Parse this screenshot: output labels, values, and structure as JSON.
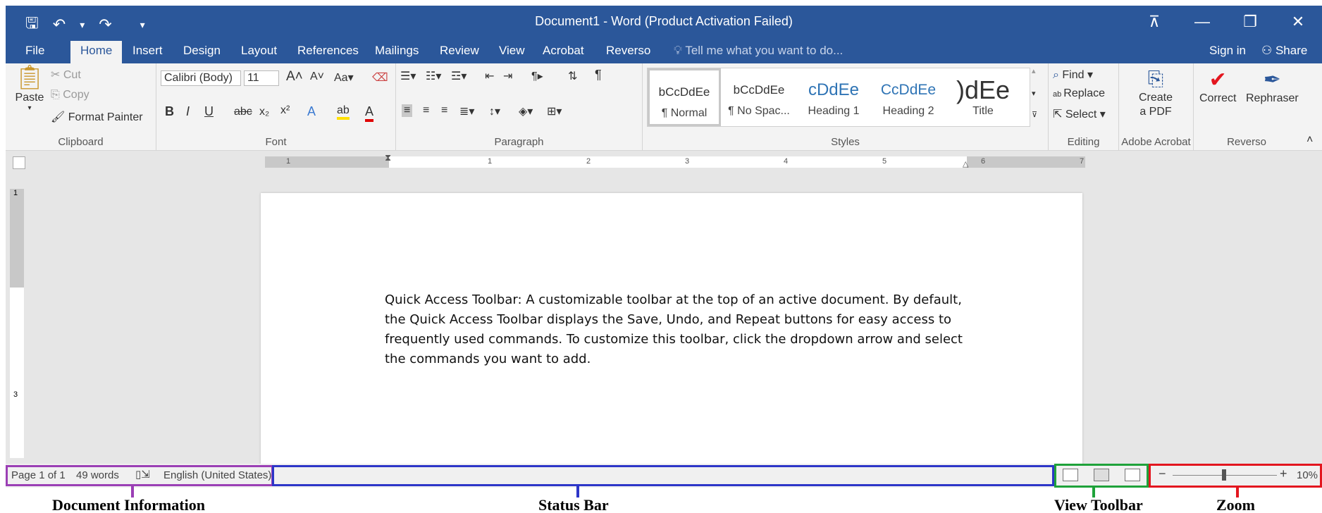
{
  "titlebar": {
    "title": "Document1 - Word (Product Activation Failed)",
    "qat": [
      {
        "icon": "save-icon",
        "glyph": "🖫"
      },
      {
        "icon": "undo-icon",
        "glyph": "↶"
      },
      {
        "icon": "undo-dropdown-icon",
        "glyph": "▾"
      },
      {
        "icon": "redo-icon",
        "glyph": "↷"
      },
      {
        "icon": "customize-qat-icon",
        "glyph": "▾"
      }
    ],
    "controls": {
      "ribbon_display": "⊼",
      "minimize": "—",
      "restore": "❐",
      "close": "✕"
    }
  },
  "tabs": [
    "File",
    "Home",
    "Insert",
    "Design",
    "Layout",
    "References",
    "Mailings",
    "Review",
    "View",
    "Acrobat",
    "Reverso"
  ],
  "active_tab": "Home",
  "tell_me": "Tell me what you want to do...",
  "sign_in": "Sign in",
  "share": "Share",
  "ribbon": {
    "clipboard": {
      "label": "Clipboard",
      "paste": "Paste",
      "cut": "Cut",
      "copy": "Copy",
      "format_painter": "Format Painter"
    },
    "font": {
      "label": "Font",
      "font_name": "Calibri (Body)",
      "font_size": "11",
      "change_case": "Aa"
    },
    "paragraph": {
      "label": "Paragraph"
    },
    "styles": {
      "label": "Styles",
      "items": [
        {
          "preview": "bCcDdEe",
          "name": "¶ Normal"
        },
        {
          "preview": "bCcDdEe",
          "name": "¶ No Spac..."
        },
        {
          "preview": "cDdEe",
          "name": "Heading 1"
        },
        {
          "preview": "CcDdEe",
          "name": "Heading 2"
        },
        {
          "preview": ")dEe",
          "name": "Title"
        }
      ]
    },
    "editing": {
      "label": "Editing",
      "find": "Find",
      "replace": "Replace",
      "select": "Select"
    },
    "acrobat": {
      "label": "Adobe Acrobat",
      "create_pdf": "Create a PDF"
    },
    "reverso": {
      "label": "Reverso",
      "correct": "Correct",
      "rephraser": "Rephraser"
    }
  },
  "ruler": {
    "h_numbers": [
      "1",
      "1",
      "2",
      "3",
      "4",
      "5",
      "6",
      "7"
    ],
    "v_numbers": [
      "1",
      "3"
    ]
  },
  "document": {
    "text": "Quick Access Toolbar: A customizable toolbar at the top of an active document. By default, the Quick Access Toolbar displays the Save, Undo, and Repeat buttons for easy access to frequently used commands. To customize this toolbar, click the dropdown arrow and select the commands you want to add."
  },
  "statusbar": {
    "page": "Page 1 of 1",
    "words": "49 words",
    "language": "English (United States)",
    "zoom_minus": "−",
    "zoom_plus": "+",
    "zoom": "10%"
  },
  "annotations": {
    "document_information": "Document Information",
    "status_bar": "Status Bar",
    "view_toolbar": "View Toolbar",
    "zoom": "Zoom"
  },
  "colors": {
    "word_blue": "#2b579a",
    "frame_purple": "#9b3fb5",
    "frame_blue": "#2d36c8",
    "frame_green": "#1fa23a",
    "frame_red": "#e3161f"
  }
}
